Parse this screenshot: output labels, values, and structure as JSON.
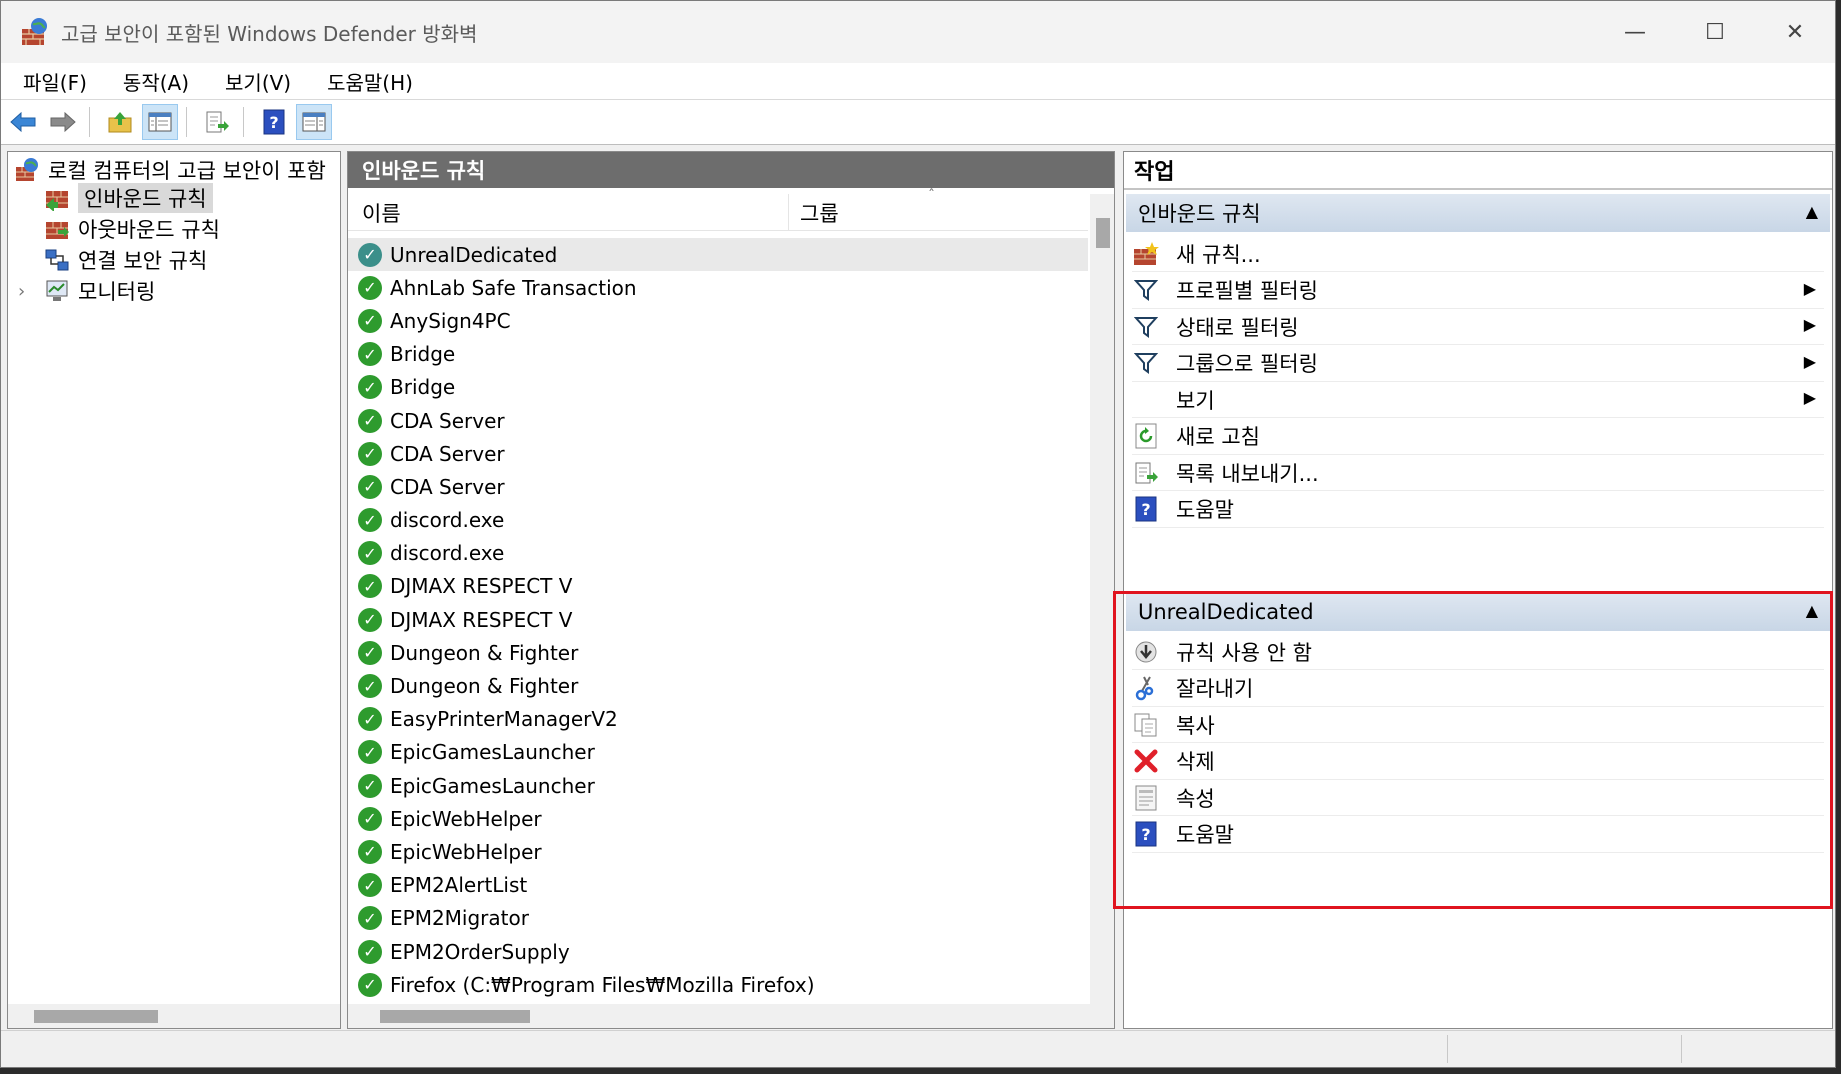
{
  "window": {
    "title": "고급 보안이 포함된 Windows Defender 방화벽",
    "controls": {
      "minimize": "—",
      "maximize": "☐",
      "close": "✕"
    }
  },
  "menu": [
    "파일(F)",
    "동작(A)",
    "보기(V)",
    "도움말(H)"
  ],
  "toolbar": {
    "icons": [
      "back-arrow-icon",
      "forward-arrow-icon",
      "up-folder-icon",
      "show-hide-console-tree-icon",
      "export-list-icon",
      "help-icon",
      "show-hide-action-pane-icon"
    ],
    "help_glyph": "?"
  },
  "tree": {
    "root": "로컬 컴퓨터의 고급 보안이 포함",
    "items": [
      {
        "label": "인바운드 규칙"
      },
      {
        "label": "아웃바운드 규칙"
      },
      {
        "label": "연결 보안 규칙"
      },
      {
        "label": "모니터링"
      }
    ],
    "expander": "›"
  },
  "middle": {
    "header": "인바운드 규칙",
    "columns": {
      "name": "이름",
      "group": "그룹",
      "sort": "ˆ"
    },
    "rules": [
      "UnrealDedicated",
      "AhnLab Safe Transaction",
      "AnySign4PC",
      "Bridge",
      "Bridge",
      "CDA Server",
      "CDA Server",
      "CDA Server",
      "discord.exe",
      "discord.exe",
      "DJMAX RESPECT V",
      "DJMAX RESPECT V",
      "Dungeon & Fighter",
      "Dungeon & Fighter",
      "EasyPrinterManagerV2",
      "EpicGamesLauncher",
      "EpicGamesLauncher",
      "EpicWebHelper",
      "EpicWebHelper",
      "EPM2AlertList",
      "EPM2Migrator",
      "EPM2OrderSupply",
      "Firefox (C:₩Program Files₩Mozilla Firefox)"
    ],
    "check_glyph": "✓"
  },
  "actions": {
    "header": "작업",
    "section1": {
      "title": "인바운드 규칙",
      "collapse": "▲",
      "items": [
        {
          "label": "새 규칙...",
          "icon": "new-rule-icon"
        },
        {
          "label": "프로필별 필터링",
          "icon": "filter-icon",
          "submenu": "▶"
        },
        {
          "label": "상태로 필터링",
          "icon": "filter-icon",
          "submenu": "▶"
        },
        {
          "label": "그룹으로 필터링",
          "icon": "filter-icon",
          "submenu": "▶"
        },
        {
          "label": "보기",
          "icon": "",
          "submenu": "▶"
        },
        {
          "label": "새로 고침",
          "icon": "refresh-icon"
        },
        {
          "label": "목록 내보내기...",
          "icon": "export-list-icon"
        },
        {
          "label": "도움말",
          "icon": "help-icon"
        }
      ]
    },
    "section2": {
      "title": "UnrealDedicated",
      "collapse": "▲",
      "items": [
        {
          "label": "규칙 사용 안 함",
          "icon": "disable-rule-icon"
        },
        {
          "label": "잘라내기",
          "icon": "scissors-icon"
        },
        {
          "label": "복사",
          "icon": "copy-icon"
        },
        {
          "label": "삭제",
          "icon": "delete-icon"
        },
        {
          "label": "속성",
          "icon": "properties-icon"
        },
        {
          "label": "도움말",
          "icon": "help-icon"
        }
      ]
    },
    "filter_glyph": "⏷",
    "delete_glyph": "✖",
    "help_glyph": "?"
  },
  "colors": {
    "highlight_box": "#e0141f",
    "pane_header": "#6d6d6d",
    "check_green": "#2e9b2e"
  }
}
